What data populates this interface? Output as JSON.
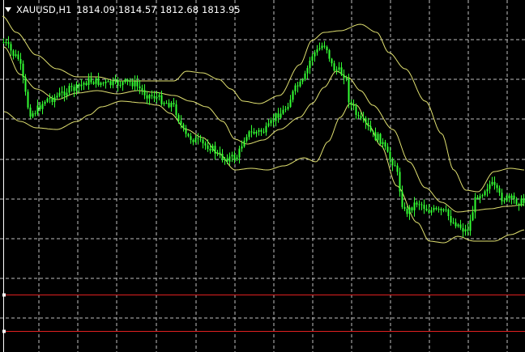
{
  "header": {
    "symbol_timeframe": "XAUUSD,H1",
    "open": "1814.09",
    "high": "1814.57",
    "low": "1812.68",
    "close": "1813.95"
  },
  "colors": {
    "background": "#000000",
    "grid": "#c0c0c0",
    "candle_bull": "#33ff33",
    "bollinger_bands": "#e0e070",
    "level_lines": "#e02020"
  },
  "chart_data": {
    "type": "candlestick",
    "symbol": "XAUUSD",
    "timeframe": "H1",
    "indicator": "Bollinger Bands",
    "grid": true,
    "horizontal_levels": 2
  }
}
